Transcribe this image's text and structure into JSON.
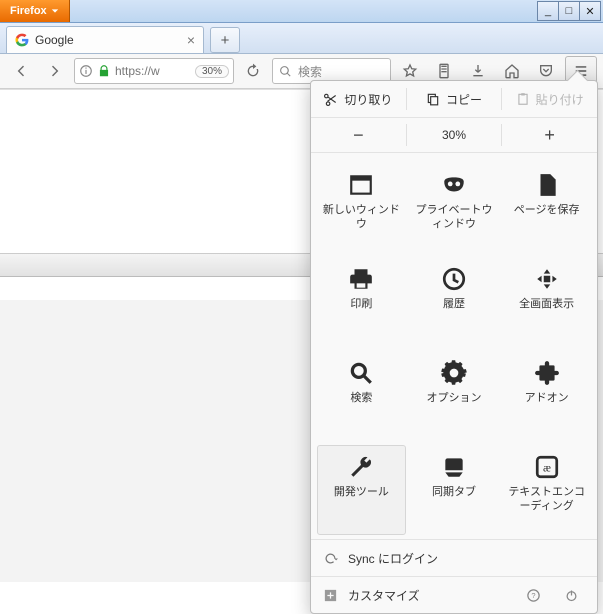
{
  "window": {
    "app_label": "Firefox"
  },
  "tab": {
    "title": "Google"
  },
  "url": {
    "text": "https://w",
    "zoom_badge": "30%"
  },
  "search": {
    "placeholder": "検索"
  },
  "menu": {
    "edit": {
      "cut": "切り取り",
      "copy": "コピー",
      "paste": "貼り付け"
    },
    "zoom": {
      "value": "30%"
    },
    "grid": {
      "new_window": "新しいウィンドウ",
      "private_window": "プライベートウィンドウ",
      "save_page": "ページを保存",
      "print": "印刷",
      "history": "履歴",
      "fullscreen": "全画面表示",
      "find": "検索",
      "options": "オプション",
      "addons": "アドオン",
      "dev_tools": "開発ツール",
      "synced_tabs": "同期タブ",
      "text_encoding": "テキストエンコーディング"
    },
    "sync": "Sync にログイン",
    "customize": "カスタマイズ"
  }
}
